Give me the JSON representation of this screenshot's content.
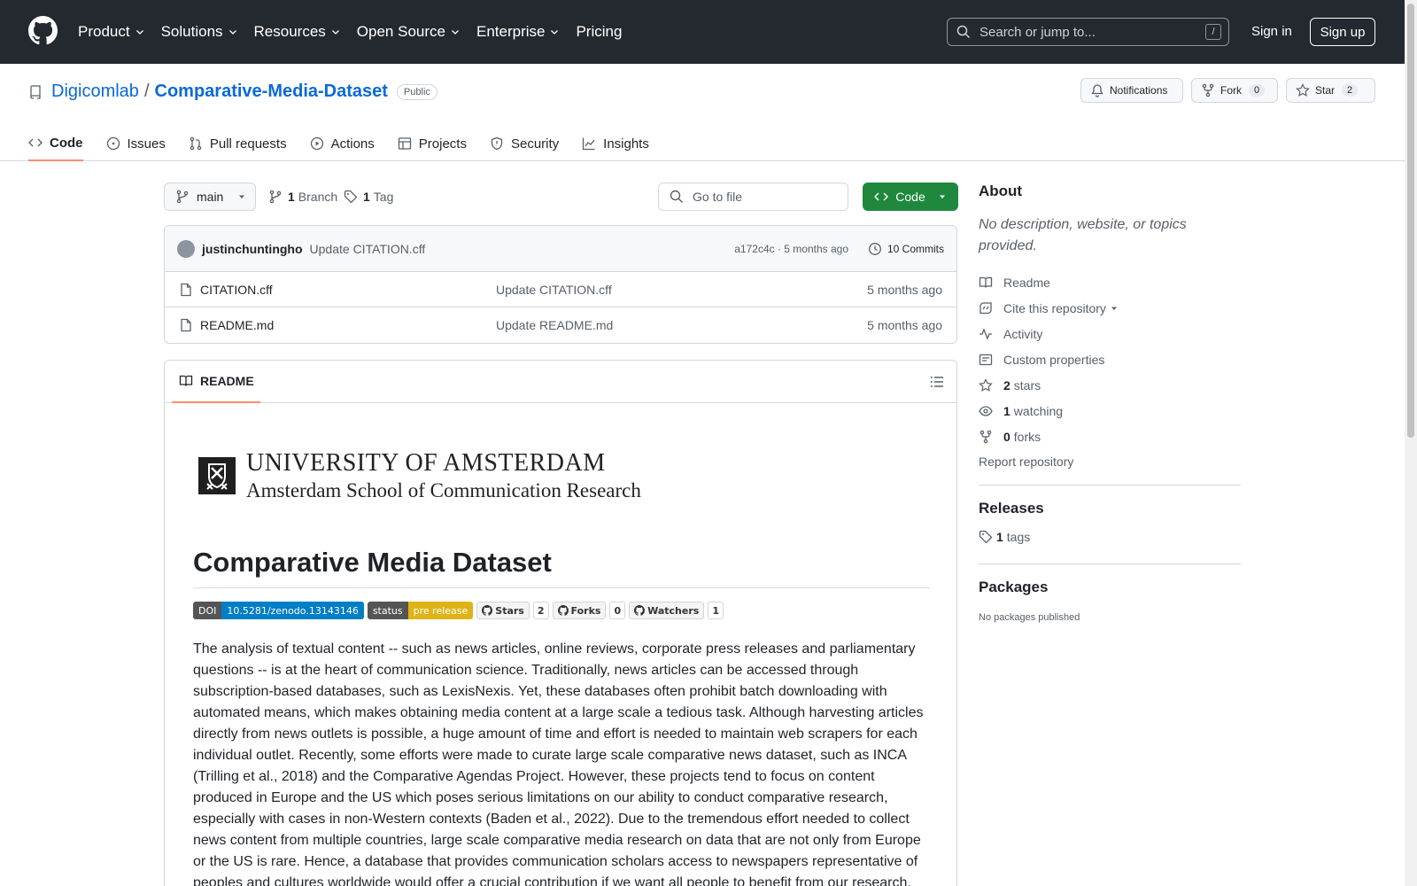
{
  "header": {
    "nav": [
      {
        "label": "Product",
        "chevron": true
      },
      {
        "label": "Solutions",
        "chevron": true
      },
      {
        "label": "Resources",
        "chevron": true
      },
      {
        "label": "Open Source",
        "chevron": true
      },
      {
        "label": "Enterprise",
        "chevron": true
      },
      {
        "label": "Pricing",
        "chevron": false
      }
    ],
    "search_placeholder": "Search or jump to...",
    "search_shortcut": "/",
    "signin": "Sign in",
    "signup": "Sign up"
  },
  "repo": {
    "owner": "Digicomlab",
    "separator": "/",
    "name": "Comparative-Media-Dataset",
    "visibility": "Public",
    "notifications": "Notifications",
    "fork_label": "Fork",
    "fork_count": "0",
    "star_label": "Star",
    "star_count": "2",
    "tabs": [
      {
        "label": "Code",
        "icon": "code-icon"
      },
      {
        "label": "Issues",
        "icon": "issue-icon"
      },
      {
        "label": "Pull requests",
        "icon": "pull-request-icon"
      },
      {
        "label": "Actions",
        "icon": "play-icon"
      },
      {
        "label": "Projects",
        "icon": "table-icon"
      },
      {
        "label": "Security",
        "icon": "shield-icon"
      },
      {
        "label": "Insights",
        "icon": "graph-icon"
      }
    ]
  },
  "toolbar": {
    "branch": "main",
    "branch_count": "1",
    "branch_label": "Branch",
    "tag_count": "1",
    "tag_label": "Tag",
    "gofile": "Go to file",
    "code_btn": "Code"
  },
  "commit": {
    "author": "justinchuntingho",
    "message": "Update CITATION.cff",
    "meta": "a172c4c · 5 months ago",
    "commits": "10 Commits"
  },
  "files": [
    {
      "name": "CITATION.cff",
      "message": "Update CITATION.cff",
      "age": "5 months ago"
    },
    {
      "name": "README.md",
      "message": "Update README.md",
      "age": "5 months ago"
    }
  ],
  "readme": {
    "tab": "README",
    "uva_line1": "UNIVERSITY OF AMSTERDAM",
    "uva_line2": "Amsterdam School of Communication Research",
    "title": "Comparative Media Dataset",
    "badges": {
      "doi_l": "DOI",
      "doi_r": "10.5281/zenodo.13143146",
      "status_l": "status",
      "status_r": "pre release",
      "stars": "Stars",
      "stars_n": "2",
      "forks": "Forks",
      "forks_n": "0",
      "watchers": "Watchers",
      "watchers_n": "1"
    },
    "body": "The analysis of textual content -- such as news articles, online reviews, corporate press releases and parliamentary questions -- is at the heart of communication science. Traditionally, news articles can be accessed through subscription-based databases, such as LexisNexis. Yet, these databases often prohibit batch downloading with automated means, which makes obtaining media content at a large scale a tedious task. Although harvesting articles directly from news outlets is possible, a huge amount of time and effort is needed to maintain web scrapers for each individual outlet. Recently, some efforts were made to curate large scale comparative news dataset, such as INCA (Trilling et al., 2018) and the Comparative Agendas Project. However, these projects tend to focus on content produced in Europe and the US which poses serious limitations on our ability to conduct comparative research, especially with cases in non-Western contexts (Baden et al., 2022). Due to the tremendous effort needed to collect news content from multiple countries, large scale comparative media research on data that are not only from Europe or the US is rare. Hence, a database that provides communication scholars access to newspapers representative of peoples and cultures worldwide would offer a crucial contribution if we want all people to benefit from our research."
  },
  "sidebar": {
    "about": "About",
    "description": "No description, website, or topics provided.",
    "readme": "Readme",
    "cite": "Cite this repository",
    "activity": "Activity",
    "custom": "Custom properties",
    "stars_n": "2",
    "stars": "stars",
    "watching_n": "1",
    "watching": "watching",
    "forks_n": "0",
    "forks": "forks",
    "report": "Report repository",
    "releases": "Releases",
    "tags_n": "1",
    "tags": "tags",
    "packages": "Packages",
    "no_packages": "No packages published"
  }
}
